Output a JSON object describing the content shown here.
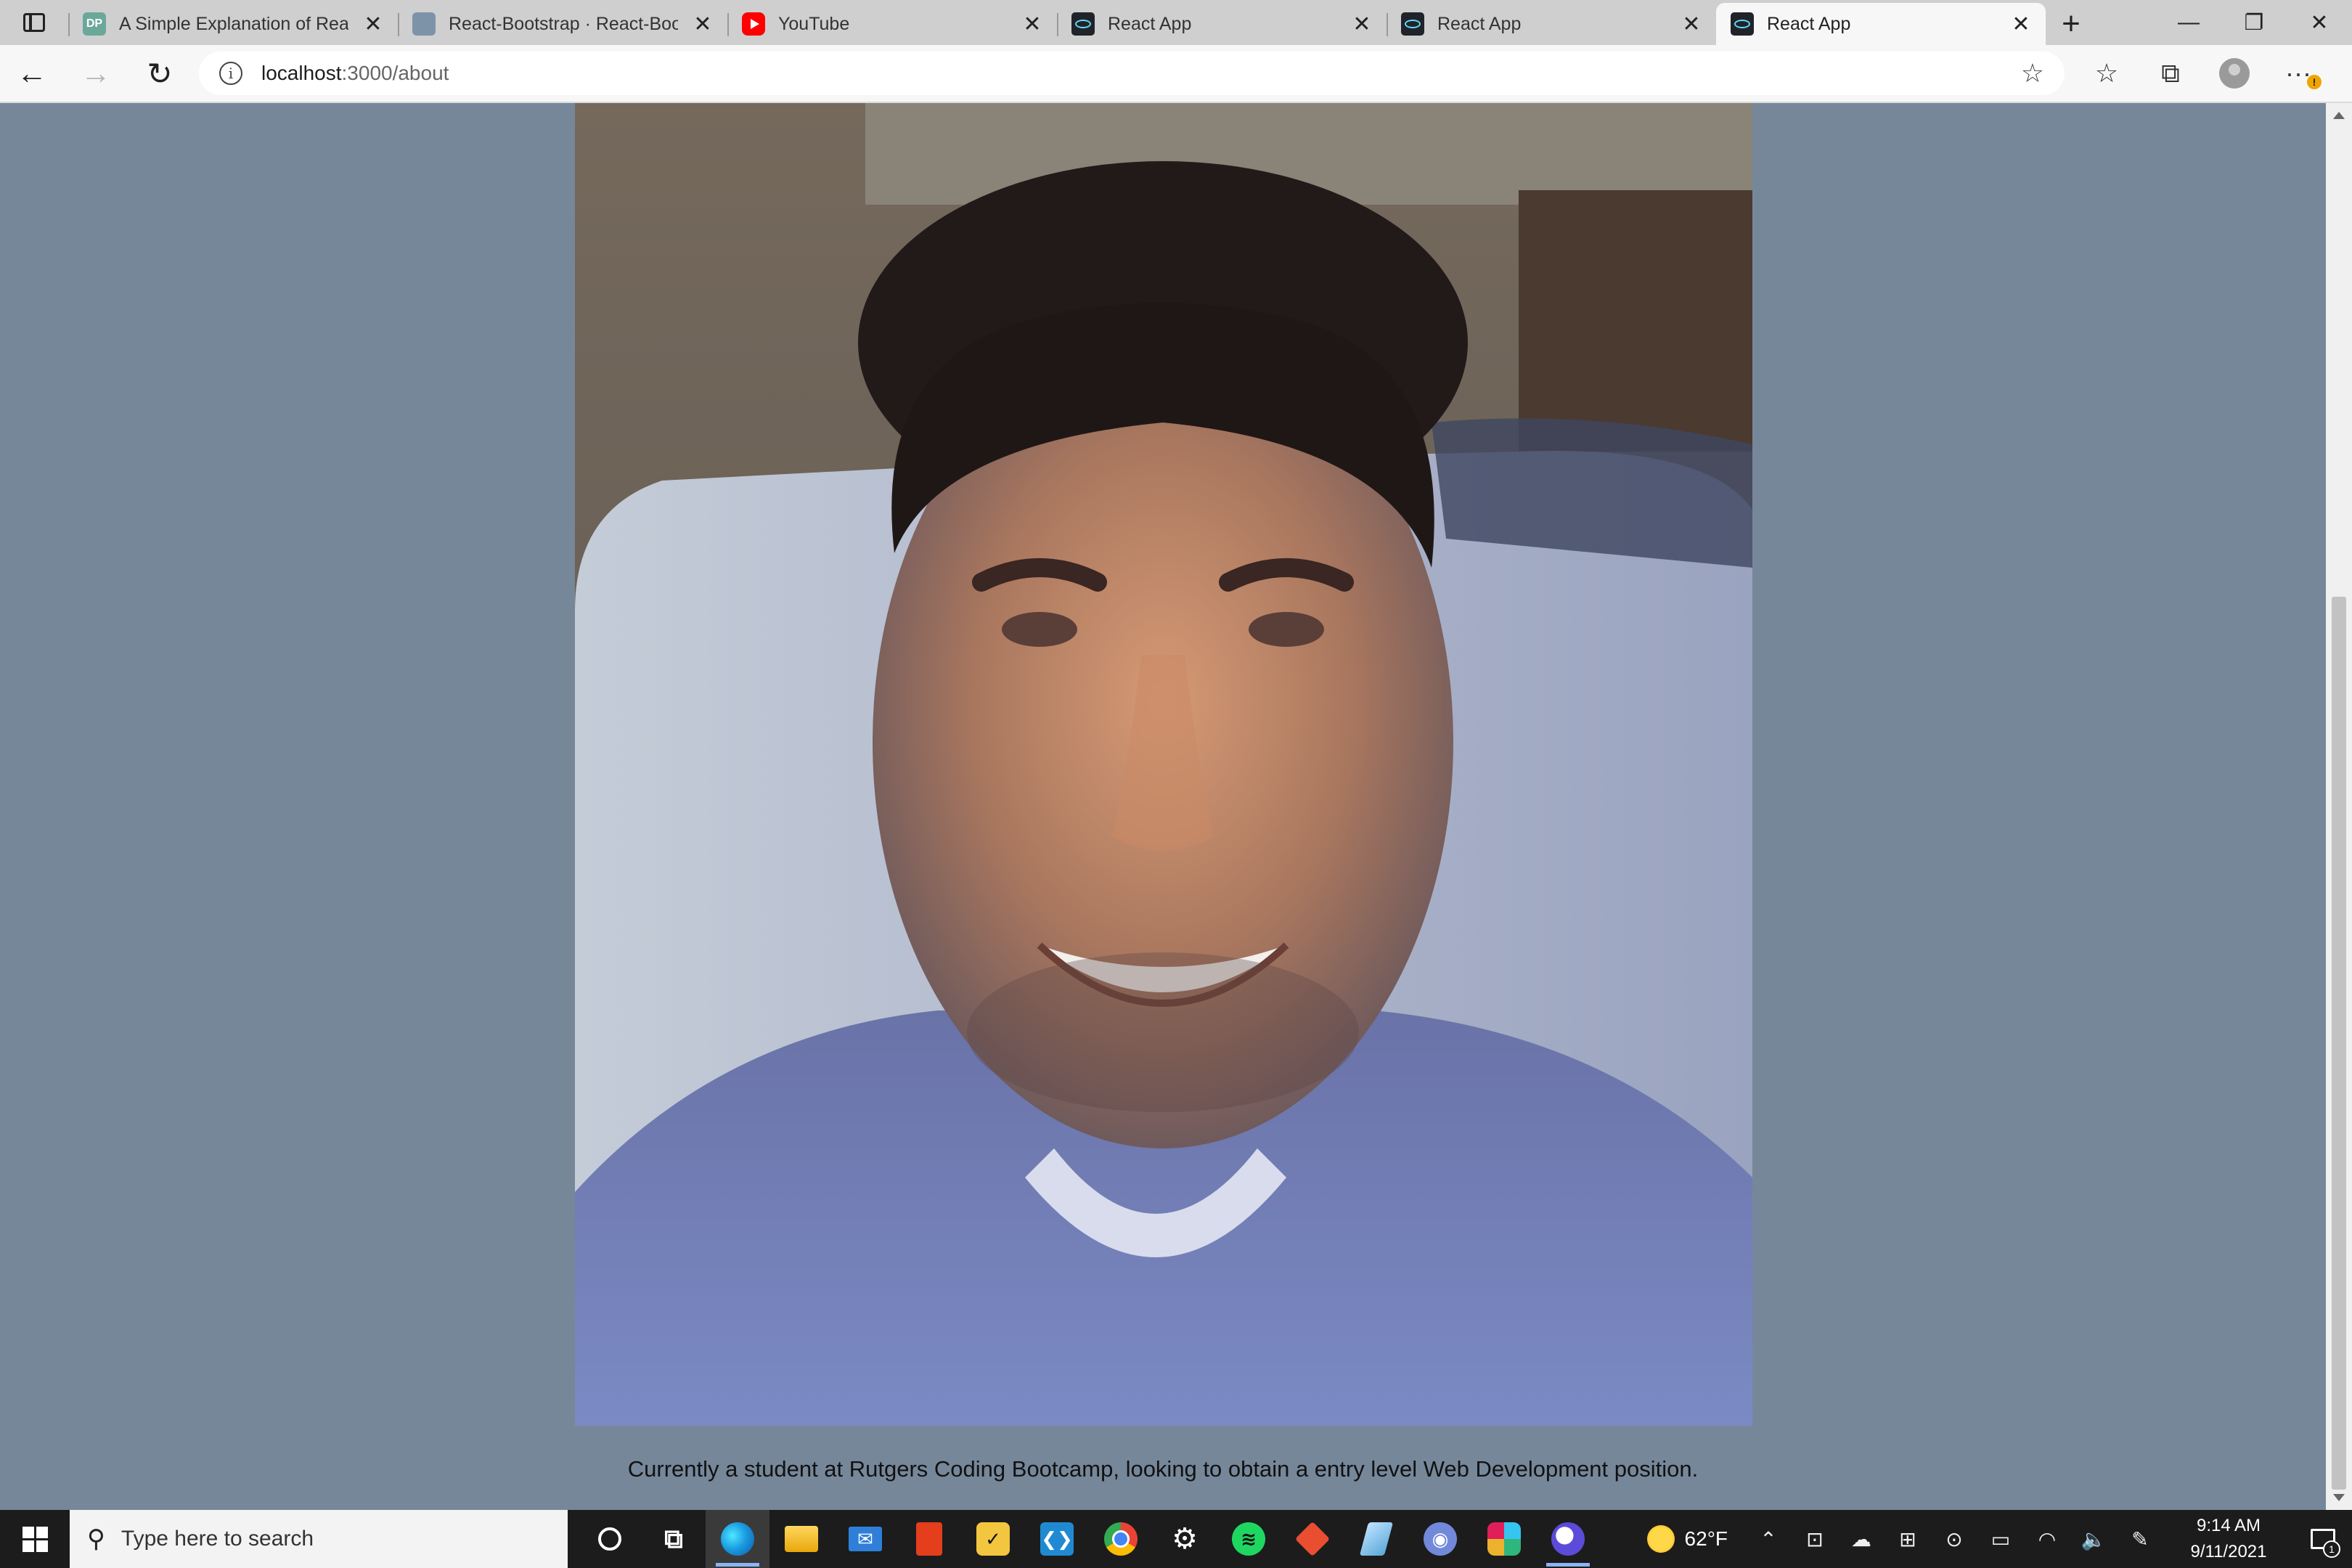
{
  "browser": {
    "tabs": [
      {
        "title": "A Simple Explanation of React.",
        "favicon": "dp-favicon",
        "favicon_text": "DP"
      },
      {
        "title": "React-Bootstrap · React-Boots",
        "favicon": "react-bootstrap-favicon",
        "favicon_text": ""
      },
      {
        "title": "YouTube",
        "favicon": "youtube-favicon",
        "favicon_text": ""
      },
      {
        "title": "React App",
        "favicon": "react-favicon",
        "favicon_text": ""
      },
      {
        "title": "React App",
        "favicon": "react-favicon",
        "favicon_text": ""
      },
      {
        "title": "React App",
        "favicon": "react-favicon",
        "favicon_text": "",
        "active": true
      }
    ],
    "tab_close_glyph": "✕",
    "new_tab_glyph": "+",
    "window_controls": {
      "minimize": "—",
      "restore": "❐",
      "close": "✕"
    },
    "nav": {
      "back": "←",
      "forward": "→",
      "refresh": "↻"
    },
    "url": {
      "host": "localhost",
      "path": ":3000/about"
    },
    "info_glyph": "i",
    "toolbar_icons": {
      "add_favorite": "☆",
      "favorites": "☆",
      "collections": "⧉",
      "more": "···"
    },
    "more_badge": "!"
  },
  "page": {
    "photo_alt": "profile-photo",
    "caption": "Currently a student at Rutgers Coding Bootcamp, looking to obtain a entry level Web Development position.",
    "background_color": "#76879a"
  },
  "taskbar": {
    "search_placeholder": "Type here to search",
    "search_glyph": "⚲",
    "apps": [
      {
        "name": "cortana-icon",
        "glyph": ""
      },
      {
        "name": "task-view-icon",
        "glyph": "⧉"
      },
      {
        "name": "edge-icon",
        "glyph": "",
        "running": true,
        "active": true
      },
      {
        "name": "file-explorer-icon",
        "glyph": ""
      },
      {
        "name": "mail-icon",
        "glyph": "✉"
      },
      {
        "name": "office-icon",
        "glyph": ""
      },
      {
        "name": "todo-icon",
        "glyph": "✓"
      },
      {
        "name": "vscode-icon",
        "glyph": "❮❯"
      },
      {
        "name": "chrome-icon",
        "glyph": ""
      },
      {
        "name": "settings-icon",
        "glyph": "⚙"
      },
      {
        "name": "spotify-icon",
        "glyph": "≋"
      },
      {
        "name": "git-icon",
        "glyph": ""
      },
      {
        "name": "pen-icon",
        "glyph": ""
      },
      {
        "name": "discord-icon",
        "glyph": "◉"
      },
      {
        "name": "slack-icon",
        "glyph": ""
      },
      {
        "name": "moon-app-icon",
        "glyph": "",
        "running": true
      }
    ],
    "weather": {
      "temp": "62°F"
    },
    "tray_icons": [
      {
        "name": "show-hidden-icon",
        "glyph": "⌃"
      },
      {
        "name": "meet-now-icon",
        "glyph": "⊡"
      },
      {
        "name": "onedrive-icon",
        "glyph": "☁"
      },
      {
        "name": "display-icon",
        "glyph": "⊞"
      },
      {
        "name": "camera-icon",
        "glyph": "⊙"
      },
      {
        "name": "battery-icon",
        "glyph": "▭"
      },
      {
        "name": "wifi-icon",
        "glyph": "◠"
      },
      {
        "name": "volume-icon",
        "glyph": "🔈"
      },
      {
        "name": "pen-workspace-icon",
        "glyph": "✎"
      }
    ],
    "clock": {
      "time": "9:14 AM",
      "date": "9/11/2021"
    },
    "notification_count": "1"
  }
}
